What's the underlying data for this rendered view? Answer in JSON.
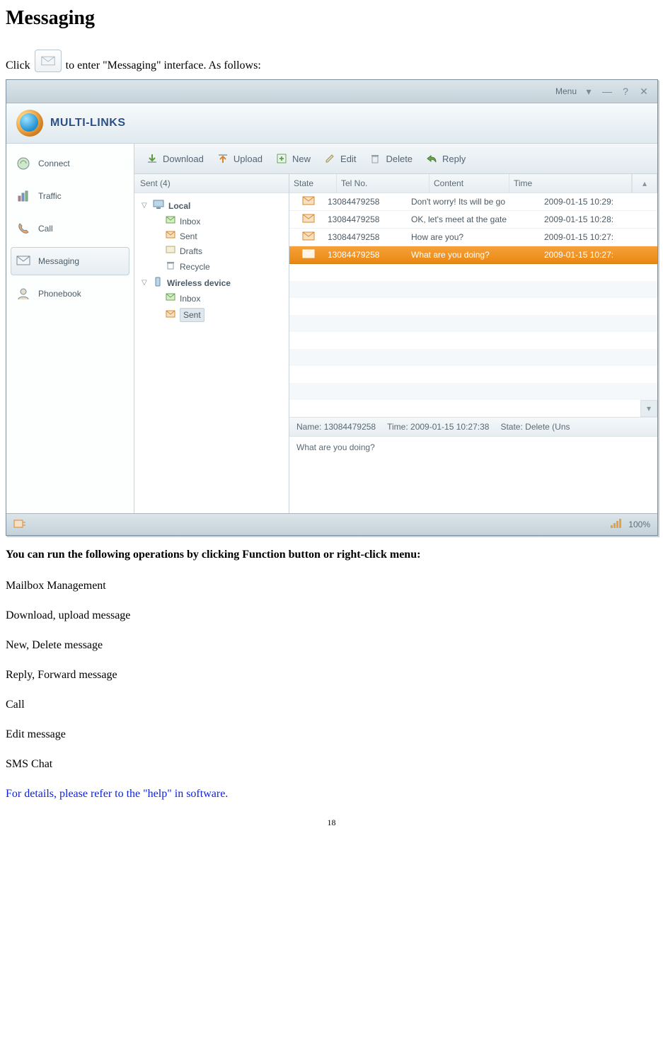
{
  "page": {
    "heading": "Messaging",
    "intro_pre": "Click ",
    "intro_post": " to enter \"Messaging\" interface. As follows:",
    "subheading": "You can run the following operations by clicking Function button or right-click menu:",
    "ops": [
      "Mailbox Management",
      "Download, upload message",
      "New, Delete message",
      "Reply, Forward message",
      "Call",
      "Edit message",
      "SMS Chat"
    ],
    "footer_link": "For details, please refer to the \"help\" in software.",
    "page_number": "18"
  },
  "app": {
    "titlebar": {
      "menu": "Menu"
    },
    "brand": "MULTI-LINKS",
    "sidenav": [
      {
        "key": "connect",
        "label": "Connect"
      },
      {
        "key": "traffic",
        "label": "Traffic"
      },
      {
        "key": "call",
        "label": "Call"
      },
      {
        "key": "messaging",
        "label": "Messaging",
        "selected": true
      },
      {
        "key": "phonebook",
        "label": "Phonebook"
      }
    ],
    "toolbar": [
      {
        "key": "download",
        "label": "Download"
      },
      {
        "key": "upload",
        "label": "Upload"
      },
      {
        "key": "new",
        "label": "New"
      },
      {
        "key": "edit",
        "label": "Edit"
      },
      {
        "key": "delete",
        "label": "Delete"
      },
      {
        "key": "reply",
        "label": "Reply"
      }
    ],
    "tree": {
      "header": "Sent (4)",
      "groups": [
        {
          "label": "Local",
          "bold": true,
          "children": [
            {
              "label": "Inbox",
              "icon": "inbox"
            },
            {
              "label": "Sent",
              "icon": "sent"
            },
            {
              "label": "Drafts",
              "icon": "drafts"
            },
            {
              "label": "Recycle",
              "icon": "recycle"
            }
          ]
        },
        {
          "label": "Wireless device",
          "bold": true,
          "children": [
            {
              "label": "Inbox",
              "icon": "inbox"
            },
            {
              "label": "Sent",
              "icon": "sent",
              "selected": true
            }
          ]
        }
      ]
    },
    "columns": {
      "state": "State",
      "tel": "Tel No.",
      "content": "Content",
      "time": "Time"
    },
    "rows": [
      {
        "tel": "13084479258",
        "content": "Don't worry! Its will be go",
        "time": "2009-01-15 10:29:"
      },
      {
        "tel": "13084479258",
        "content": "OK, let's meet at the gate",
        "time": "2009-01-15 10:28:"
      },
      {
        "tel": "13084479258",
        "content": "How are you?",
        "time": "2009-01-15 10:27:"
      },
      {
        "tel": "13084479258",
        "content": "What are you doing?",
        "time": "2009-01-15 10:27:",
        "selected": true
      }
    ],
    "meta": {
      "name_label": "Name:",
      "name": "13084479258",
      "time_label": "Time:",
      "time": "2009-01-15 10:27:38",
      "state_label": "State:",
      "state": "Delete (Uns"
    },
    "preview": "What are you doing?",
    "status": {
      "signal": "100%"
    }
  }
}
